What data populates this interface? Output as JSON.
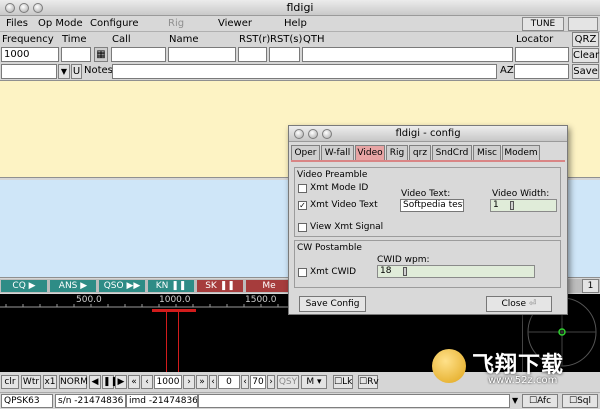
{
  "window": {
    "title": "fldigi"
  },
  "menu": {
    "items": [
      "Files",
      "Op Mode",
      "Configure",
      "Rig",
      "Viewer",
      "Help"
    ],
    "tune": "TUNE"
  },
  "log": {
    "labels": {
      "frequency": "Frequency",
      "time": "Time",
      "call": "Call",
      "name": "Name",
      "rst_r": "RST(r)",
      "rst_s": "RST(s)",
      "qth": "QTH",
      "locator": "Locator",
      "notes": "Notes",
      "az": "AZ"
    },
    "frequency_value": "1000",
    "buttons": {
      "qrz": "QRZ",
      "clear": "Clear",
      "save": "Save",
      "u": "U",
      "dropdown": "▼"
    }
  },
  "macros": {
    "items": [
      {
        "label": "CQ",
        "color": "#2e8c86"
      },
      {
        "label": "ANS",
        "color": "#2e8c86"
      },
      {
        "label": "QSO",
        "color": "#2e8c86"
      },
      {
        "label": "KN",
        "color": "#2e8c86"
      },
      {
        "label": "SK",
        "color": "#a63c3c"
      },
      {
        "label": "Me",
        "color": "#a63c3c"
      }
    ],
    "page": "1"
  },
  "waterfall": {
    "scale": [
      "500.0",
      "1000.0",
      "1500.0"
    ],
    "cursor_color": "#d21c1c"
  },
  "controls": {
    "clr": "clr",
    "wtr": "Wtr",
    "x1": "x1",
    "norm": "NORM",
    "freq_value": "1000",
    "offset_value": "0",
    "speed_value": "70",
    "qsy": "QSY",
    "m": "M",
    "lk": "Lk",
    "rv": "Rv"
  },
  "status": {
    "mode": "QPSK63",
    "sn": "s/n -21474836",
    "imd": "imd -21474836",
    "afc": "Afc",
    "sql": "Sql"
  },
  "dialog": {
    "title": "fldigi - config",
    "tabs": [
      "Oper",
      "W-fall",
      "Video",
      "Rig",
      "qrz",
      "SndCrd",
      "Misc",
      "Modem"
    ],
    "active_tab": "Video",
    "preamble": {
      "title": "Video Preamble",
      "xmt_mode_id": "Xmt Mode ID",
      "xmt_mode_id_checked": false,
      "xmt_video_text": "Xmt Video Text",
      "xmt_video_text_checked": true,
      "video_text_label": "Video Text:",
      "video_text_value": "Softpedia test",
      "video_width_label": "Video Width:",
      "video_width_value": "1",
      "video_width_fraction": 0.1,
      "view_xmt_signal": "View Xmt Signal",
      "view_xmt_signal_checked": false
    },
    "postamble": {
      "title": "CW Postamble",
      "xmt_cwid": "Xmt CWID",
      "xmt_cwid_checked": false,
      "cwid_wpm_label": "CWID wpm:",
      "cwid_wpm_value": "18",
      "cwid_wpm_fraction": 0.08
    },
    "save_button": "Save Config",
    "close_button": "Close"
  },
  "watermark": {
    "text": "飞翔下载",
    "url": "www.52z.com"
  }
}
